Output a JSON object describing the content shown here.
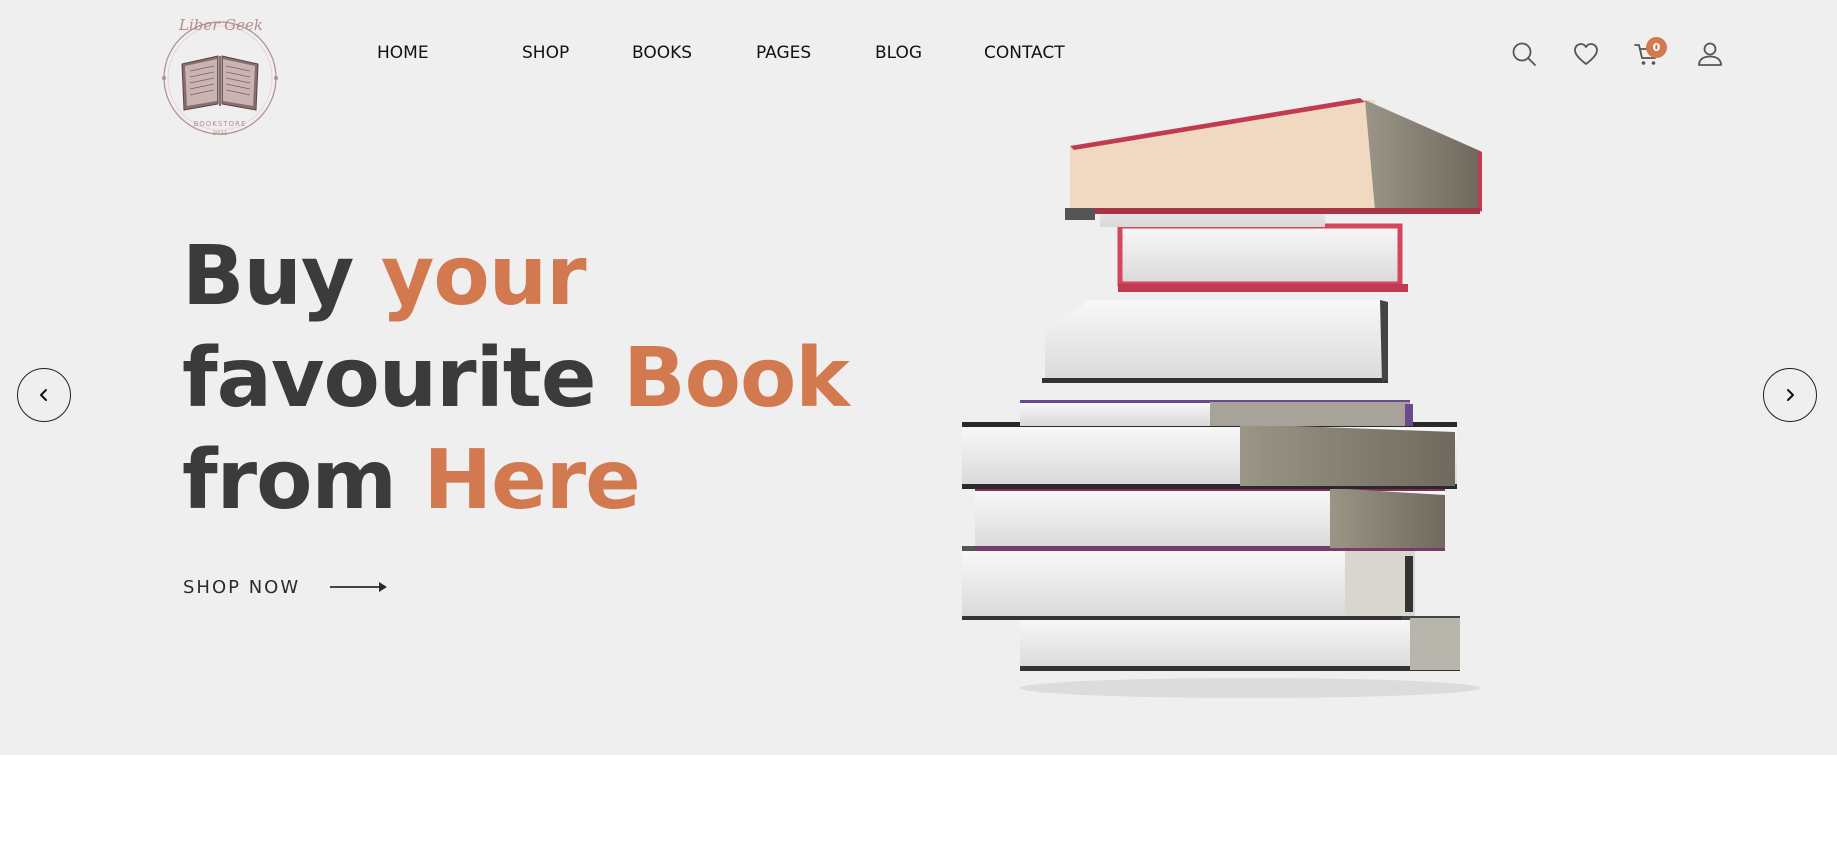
{
  "brand": {
    "logo_script": "Liber Geek",
    "logo_subtitle": "BOOKSTORE",
    "logo_year": "2021",
    "icon": "open-book-emblem-icon"
  },
  "nav": {
    "items": [
      {
        "label": "HOME"
      },
      {
        "label": "SHOP"
      },
      {
        "label": "BOOKS"
      },
      {
        "label": "PAGES"
      },
      {
        "label": "BLOG"
      },
      {
        "label": "CONTACT"
      }
    ]
  },
  "header_icons": {
    "search": "search-icon",
    "wishlist": "heart-icon",
    "cart": "cart-icon",
    "account": "user-icon",
    "cart_count": "0"
  },
  "hero": {
    "line1_plain": "Buy",
    "line1_accent": "your",
    "line2_plain": "favourite",
    "line2_accent": "Book",
    "line3_plain": "from",
    "line3_accent": "Here",
    "cta_label": "SHOP NOW",
    "prev_icon": "chevron-left-icon",
    "next_icon": "chevron-right-icon"
  },
  "colors": {
    "hero_background": "#f0efef",
    "accent": "#d2794f",
    "heading": "#3b3b3b",
    "nav_text": "#111111"
  }
}
